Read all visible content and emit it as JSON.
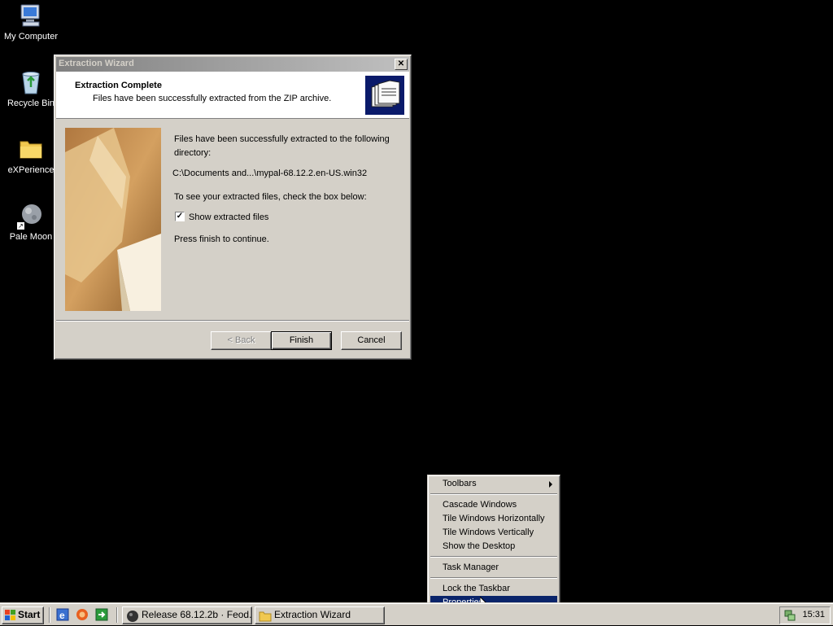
{
  "desktop": {
    "icons": [
      {
        "label": "My Computer",
        "icon": "my-computer-icon"
      },
      {
        "label": "Recycle Bin",
        "icon": "recycle-bin-icon"
      },
      {
        "label": "eXPerience",
        "icon": "folder-icon"
      },
      {
        "label": "Pale Moon",
        "icon": "pale-moon-icon"
      }
    ]
  },
  "wizard": {
    "title": "Extraction Wizard",
    "close_label": "✕",
    "header_title": "Extraction Complete",
    "header_subtitle": "Files have been successfully extracted from the ZIP archive.",
    "line1": "Files have been successfully extracted to the following",
    "line2": "directory:",
    "path": "C:\\Documents and...\\mypal-68.12.2.en-US.win32",
    "see_files": "To see your extracted files, check the box below:",
    "checkbox_label": "Show extracted files",
    "checkbox_checked": true,
    "press_finish": "Press finish to continue.",
    "back_label": "< Back",
    "finish_label": "Finish",
    "cancel_label": "Cancel"
  },
  "context_menu": {
    "items": [
      {
        "label": "Toolbars",
        "submenu": true
      },
      {
        "label": "Cascade Windows"
      },
      {
        "label": "Tile Windows Horizontally"
      },
      {
        "label": "Tile Windows Vertically"
      },
      {
        "label": "Show the Desktop"
      },
      {
        "label": "Task Manager"
      },
      {
        "label": "Lock the Taskbar"
      },
      {
        "label": "Properties",
        "highlighted": true
      }
    ]
  },
  "taskbar": {
    "start_label": "Start",
    "quick_launch": [
      "ie-icon",
      "browser-icon",
      "show-desktop-icon"
    ],
    "tasks": [
      {
        "label": "Release 68.12.2b · Feod...",
        "icon": "pale-moon-icon"
      },
      {
        "label": "Extraction Wizard",
        "icon": "folder-icon"
      }
    ],
    "clock": "15:31"
  },
  "colors": {
    "desktop_bg": "#000000",
    "face": "#d4d0c8",
    "highlight": "#0a246a"
  }
}
